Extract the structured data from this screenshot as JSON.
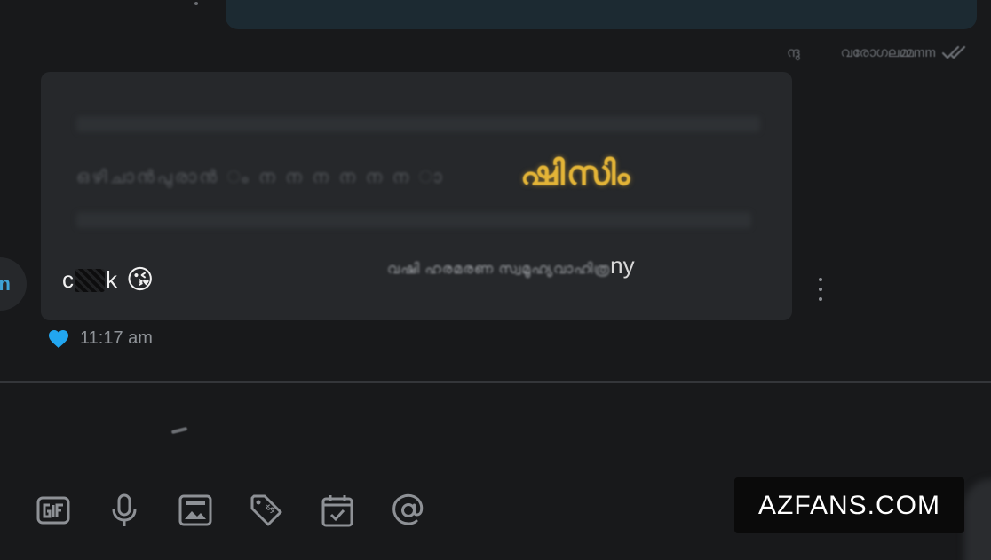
{
  "thread": {
    "sent_meta": {
      "label_a": "ന്ദു",
      "label_b": "വരോഗലമ്മmm",
      "status_icon": "double-check-icon"
    },
    "received": {
      "avatar_letter": "n",
      "quote": {
        "ghost_line": "ഒഴിചാൻപുരാൻ ം ന ന ന ന ന ന ാ",
        "gold_title": "ഷിസിം",
        "last_line_fade": "വഷി ഹരമരണ സ്വമൂഹ്യവാഹിത്ര",
        "last_line_tail": "ny"
      },
      "message_prefix": "c",
      "message_suffix": "k",
      "emoji": "😘",
      "reaction_icon": "heart-icon",
      "time": "11:17 am"
    }
  },
  "composer": {
    "toolbar": [
      {
        "name": "gif-button",
        "icon": "gif-icon"
      },
      {
        "name": "microphone-button",
        "icon": "microphone-icon"
      },
      {
        "name": "image-button",
        "icon": "image-icon"
      },
      {
        "name": "tip-button",
        "icon": "price-tag-dollar-icon"
      },
      {
        "name": "schedule-button",
        "icon": "calendar-check-icon"
      },
      {
        "name": "mention-button",
        "icon": "at-sign-icon"
      }
    ]
  },
  "watermark": "AZFANS.COM",
  "colors": {
    "background": "#18191b",
    "bubble": "#26282b",
    "sent_bubble": "#1c2a32",
    "accent": "#3fa3d6",
    "heart": "#22a6f0",
    "gold": "#e3b437"
  }
}
